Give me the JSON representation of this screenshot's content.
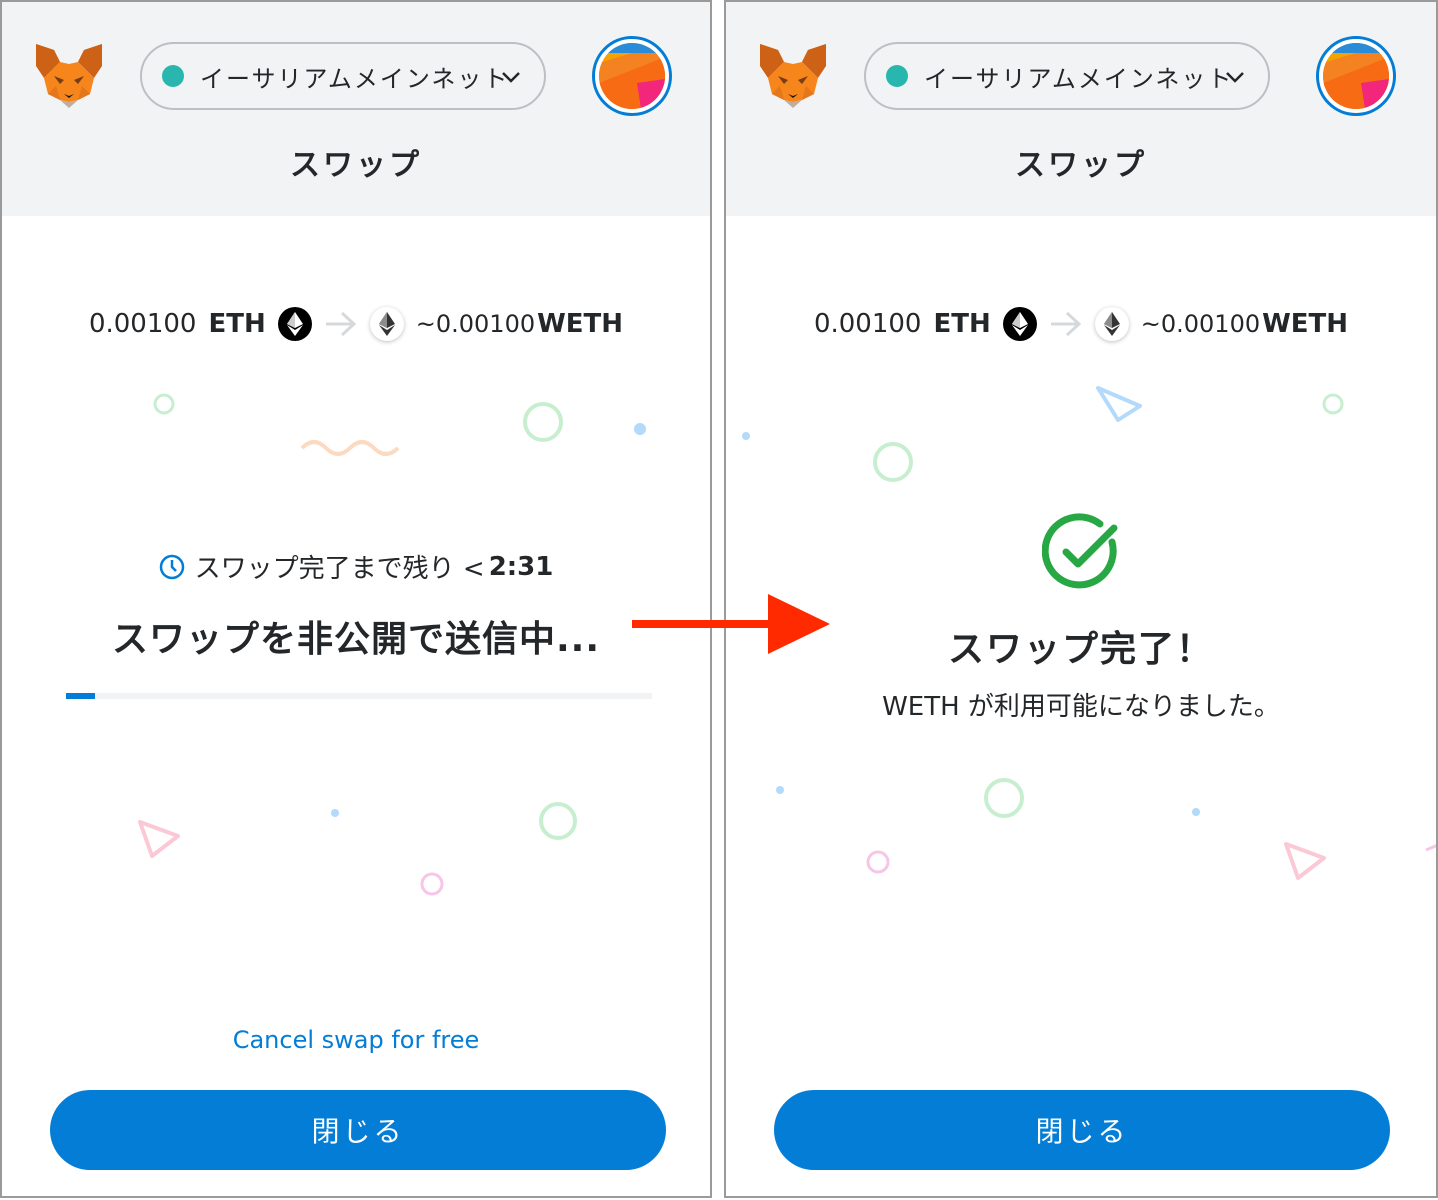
{
  "left_panel": {
    "network": {
      "label": "イーサリアムメインネット",
      "dot_color": "#29b6af"
    },
    "title": "スワップ",
    "pair": {
      "from_amount": "0.00100",
      "from_symbol": "ETH",
      "to_amount": "~0.00100",
      "to_symbol": "WETH"
    },
    "timer": {
      "text": "スワップ完了まで残り <",
      "value": "2:31"
    },
    "status": "スワップを非公開で送信中...",
    "progress": 0.05,
    "cancel_label": "Cancel swap for free",
    "close_label": "閉じる"
  },
  "right_panel": {
    "network": {
      "label": "イーサリアムメインネット",
      "dot_color": "#29b6af"
    },
    "title": "スワップ",
    "pair": {
      "from_amount": "0.00100",
      "from_symbol": "ETH",
      "to_amount": "~0.00100",
      "to_symbol": "WETH"
    },
    "done_title": "スワップ完了！",
    "done_subtitle": "WETH が利用可能になりました。",
    "close_label": "閉じる"
  },
  "colors": {
    "primary": "#037dd6",
    "success": "#28a745",
    "arrow": "#ff2a00"
  },
  "icons": [
    "metamask-fox-icon",
    "chevron-down-icon",
    "account-avatar",
    "eth-icon",
    "arrow-right-icon",
    "clock-icon",
    "check-circle-icon"
  ]
}
